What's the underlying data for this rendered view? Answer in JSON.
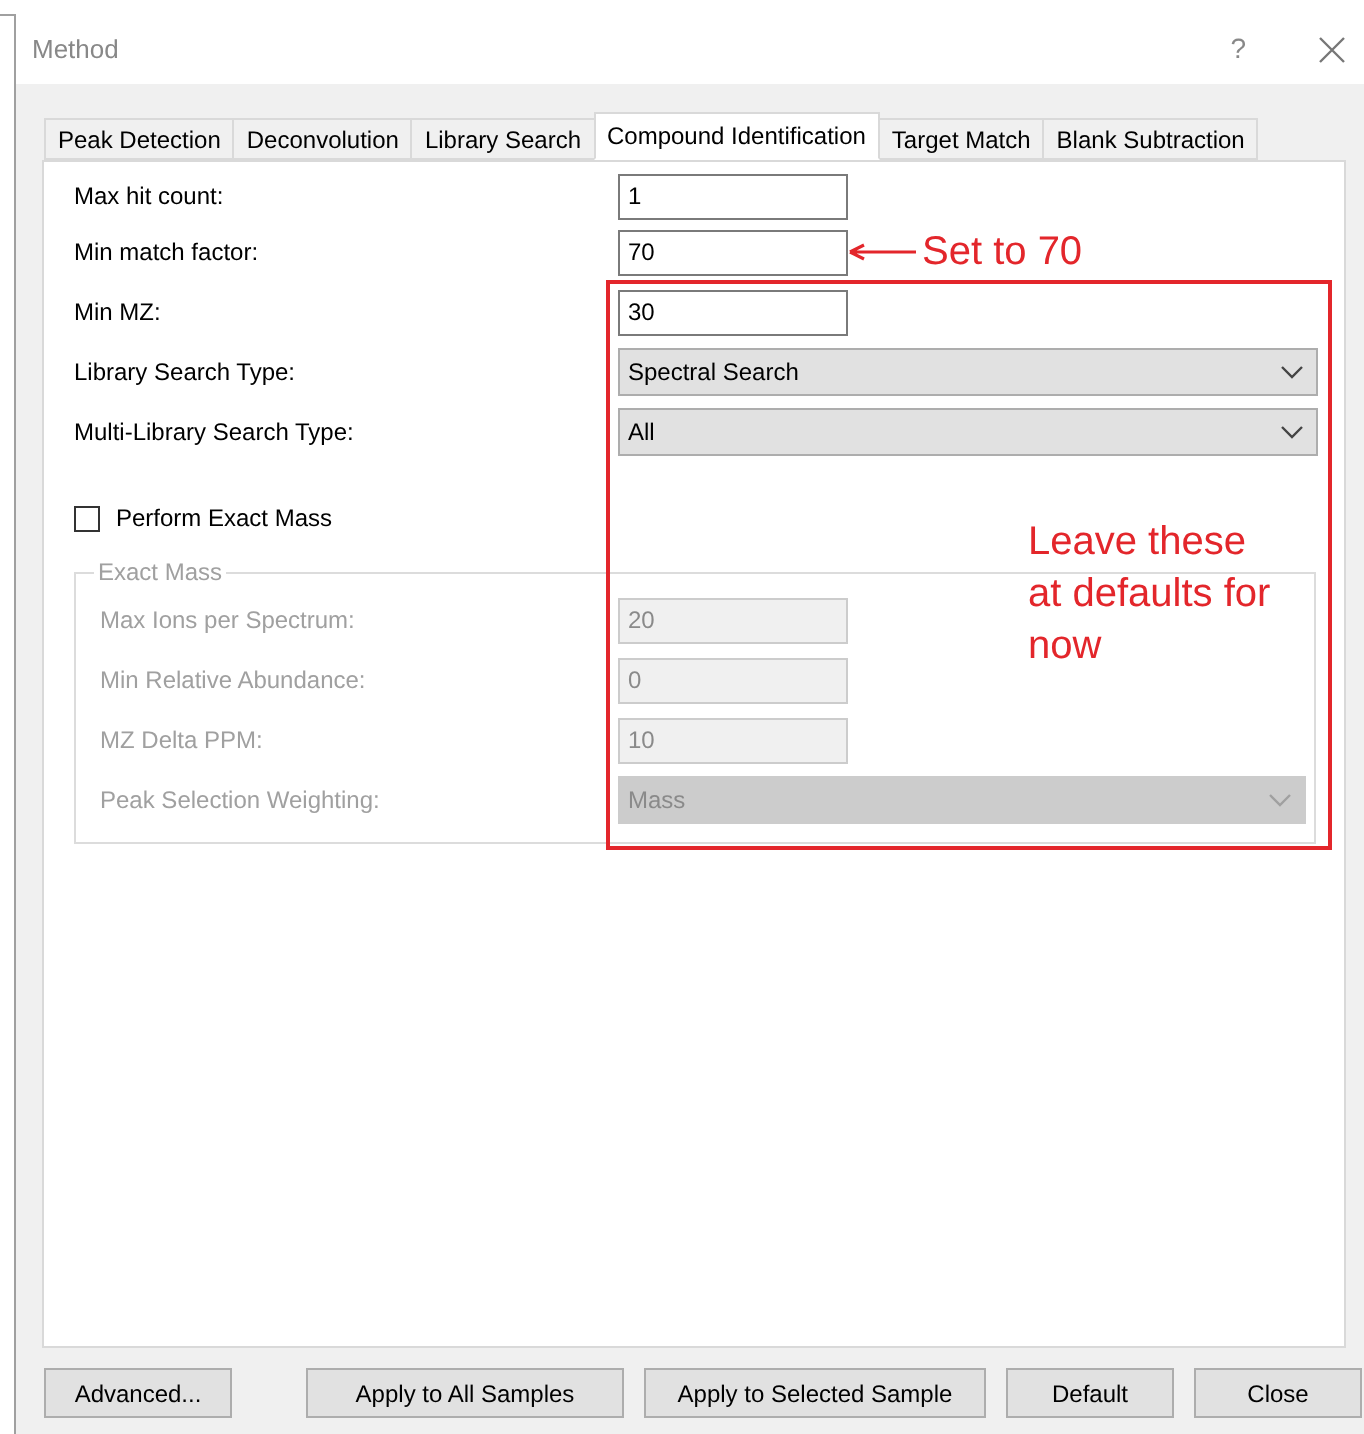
{
  "window": {
    "title": "Method",
    "help": "?"
  },
  "tabs": [
    {
      "label": "Peak Detection",
      "selected": false
    },
    {
      "label": "Deconvolution",
      "selected": false
    },
    {
      "label": "Library Search",
      "selected": false
    },
    {
      "label": "Compound Identification",
      "selected": true
    },
    {
      "label": "Target Match",
      "selected": false
    },
    {
      "label": "Blank Subtraction",
      "selected": false
    }
  ],
  "fields": [
    {
      "label": "Max hit count:",
      "kind": "text",
      "value": "1"
    },
    {
      "label": "Min match factor:",
      "kind": "text",
      "value": "70"
    },
    {
      "label": "Min MZ:",
      "kind": "text",
      "value": "30"
    },
    {
      "label": "Library Search Type:",
      "kind": "select",
      "value": "Spectral Search"
    },
    {
      "label": "Multi-Library Search Type:",
      "kind": "select",
      "value": "All"
    }
  ],
  "exact_mass_checkbox": {
    "label": "Perform Exact Mass",
    "checked": false
  },
  "exact_mass_group": {
    "title": "Exact Mass",
    "disabled": true,
    "fields": [
      {
        "label": "Max Ions per Spectrum:",
        "kind": "text",
        "value": "20"
      },
      {
        "label": "Min Relative Abundance:",
        "kind": "text",
        "value": "0"
      },
      {
        "label": "MZ Delta PPM:",
        "kind": "text",
        "value": "10"
      },
      {
        "label": "Peak Selection Weighting:",
        "kind": "select",
        "value": "Mass"
      }
    ]
  },
  "annotations": [
    {
      "kind": "arrow",
      "text": "Set to 70"
    },
    {
      "kind": "box",
      "text": "Leave these at defaults for now"
    }
  ],
  "buttons": [
    "Advanced...",
    "Apply to All Samples",
    "Apply to Selected Sample",
    "Default",
    "Close"
  ]
}
